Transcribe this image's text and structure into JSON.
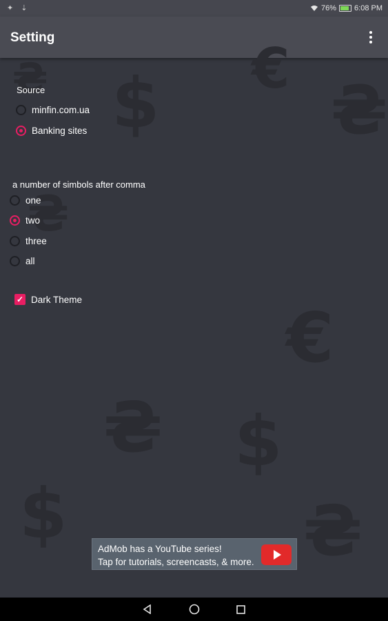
{
  "status_bar": {
    "left_icons": "✦ ⇣",
    "battery_text": "76%",
    "time": "6:08 PM"
  },
  "app_bar": {
    "title": "Setting",
    "menu_icon": "more-vert-icon"
  },
  "source": {
    "label": "Source",
    "options": [
      {
        "label": "minfin.com.ua",
        "selected": false
      },
      {
        "label": "Banking sites",
        "selected": true
      }
    ]
  },
  "decimals": {
    "label": "a number of simbols after comma",
    "options": [
      {
        "label": "one",
        "selected": false
      },
      {
        "label": "two",
        "selected": true
      },
      {
        "label": "three",
        "selected": false
      },
      {
        "label": "all",
        "selected": false
      }
    ]
  },
  "theme": {
    "label": "Dark Theme",
    "checked": true
  },
  "ad": {
    "line1": "AdMob has a YouTube series!",
    "line2": "Tap for tutorials, screencasts, & more."
  },
  "colors": {
    "accent": "#e91e63",
    "background": "#35373f",
    "app_bar": "#4a4b53"
  },
  "nav": {
    "icons": [
      "back-icon",
      "home-icon",
      "recents-icon"
    ]
  }
}
